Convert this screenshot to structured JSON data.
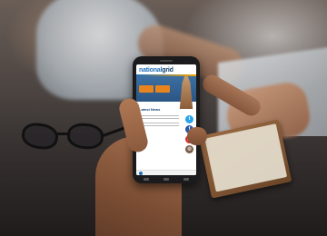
{
  "app": {
    "logo_part1": "national",
    "logo_part2": "grid"
  },
  "content": {
    "section_title": "Latest News",
    "news": [
      {
        "date": "",
        "text": ""
      },
      {
        "date": "",
        "text": ""
      }
    ]
  },
  "social_icons": [
    "twitter-icon",
    "facebook-icon",
    "youtube-icon",
    "instagram-icon"
  ],
  "colors": {
    "brand_blue": "#1e6fb7",
    "brand_navy": "#0f3d6e",
    "accent_orange": "#e7841e"
  }
}
